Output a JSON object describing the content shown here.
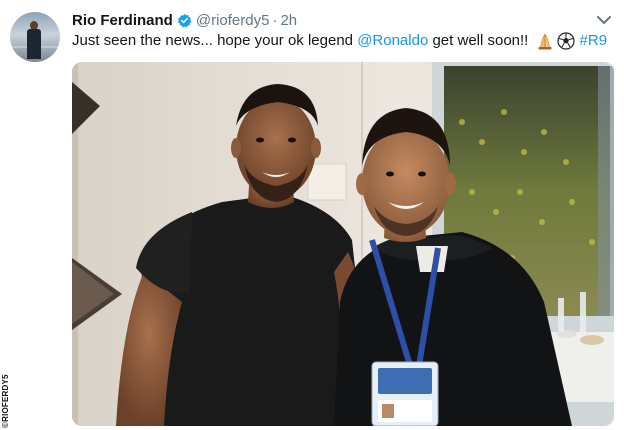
{
  "tweet": {
    "author_name": "Rio Ferdinand",
    "author_handle": "@rioferdy5",
    "separator": "·",
    "timestamp": "2h",
    "verified": true,
    "text_before_mention": "Just seen the news... hope your ok legend ",
    "mention": "@Ronaldo",
    "text_after_mention": " get well soon!! ",
    "emojis": [
      "praying-hands-emoji",
      "soccer-ball-emoji"
    ],
    "hashtag": "#R9",
    "photo_subject": "two-men-smiling-photo"
  },
  "watermark": "©RIOFERDY5",
  "colors": {
    "link": "#1b95e0",
    "verified_badge": "#1da1f2",
    "muted": "#657786",
    "text": "#14171a"
  }
}
